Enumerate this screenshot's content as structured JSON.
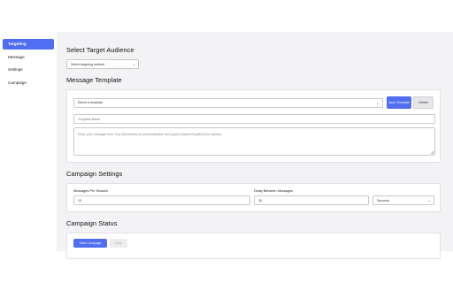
{
  "sidebar": {
    "items": [
      {
        "label": "Targeting",
        "active": true
      },
      {
        "label": "Message",
        "active": false
      },
      {
        "label": "Settings",
        "active": false
      },
      {
        "label": "Campaign",
        "active": false
      }
    ]
  },
  "audience": {
    "title": "Select Target Audience",
    "select_value": "Select targeting method"
  },
  "template": {
    "title": "Message Template",
    "select_value": "Select a template",
    "save_label": "Save Template",
    "delete_label": "Delete",
    "name_placeholder": "Template Name",
    "message_placeholder": "Enter your message here. Use {firstname} for personalization and [option1|option2|option3] for spintax."
  },
  "settings": {
    "title": "Campaign Settings",
    "messages_label": "Messages Per Session",
    "messages_value": "10",
    "delay_label": "Delay Between Messages",
    "delay_value": "30",
    "delay_unit": "Seconds"
  },
  "status": {
    "title": "Campaign Status",
    "start_label": "Start Campaign",
    "stop_label": "Stop"
  },
  "colors": {
    "accent": "#4f6ef2",
    "background": "#f3f3f5"
  }
}
